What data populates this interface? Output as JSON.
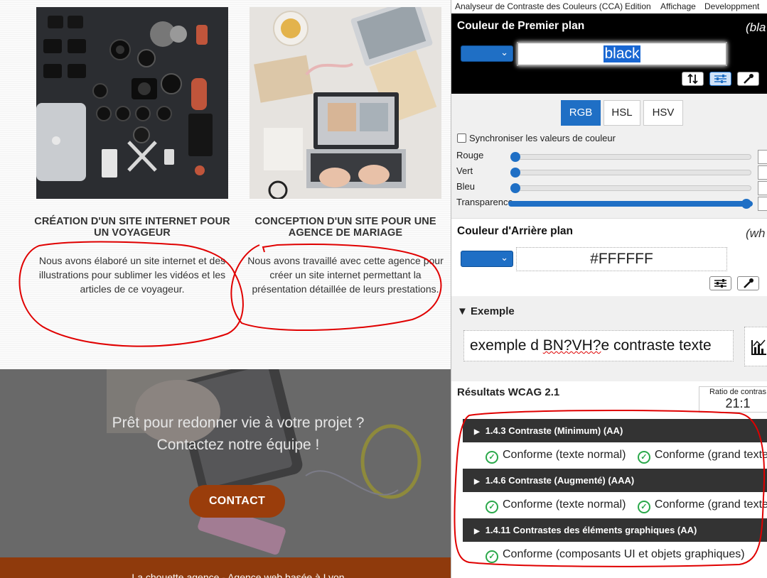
{
  "site": {
    "cards": [
      {
        "title": "CRÉATION D'UN SITE INTERNET POUR UN VOYAGEUR",
        "text": "Nous avons élaboré un site internet et des illustrations pour sublimer les vidéos et les articles de ce voyageur."
      },
      {
        "title": "CONCEPTION D'UN SITE POUR UNE AGENCE DE MARIAGE",
        "text": "Nous avons travaillé avec cette agence pour créer un site internet permettant la présentation détaillée de leurs prestations."
      }
    ],
    "cta": {
      "line1": "Prêt pour redonner vie à votre projet ?",
      "line2": "Contactez notre équipe !",
      "button": "CONTACT"
    },
    "footer": "La chouette agence - Agence web basée à Lyon"
  },
  "cca": {
    "menu": [
      "Analyseur de Contraste des Couleurs (CCA)",
      "Edition",
      "Affichage",
      "Developpment"
    ],
    "foreground": {
      "title": "Couleur de Premier plan",
      "name": "(bla",
      "value": "black"
    },
    "tabs": [
      "RGB",
      "HSL",
      "HSV"
    ],
    "sync_label": "Synchroniser les valeurs de couleur",
    "sliders": [
      {
        "label": "Rouge",
        "level": 0
      },
      {
        "label": "Vert",
        "level": 0
      },
      {
        "label": "Bleu",
        "level": 0
      },
      {
        "label": "Transparence",
        "level": 1
      }
    ],
    "background": {
      "title": "Couleur d'Arrière plan",
      "name": "(wh",
      "value": "#FFFFFF"
    },
    "example": {
      "title": "Exemple",
      "text_a": "exemple d ",
      "text_b": "BN?VH?",
      "text_c": "e contraste texte"
    },
    "results": {
      "title": "Résultats WCAG 2.1",
      "ratio_label": "Ratio de contras",
      "ratio_value": "21:1",
      "criteria": [
        {
          "title": "1.4.3 Contraste (Minimum) (AA)",
          "pass_normal": "Conforme (texte normal)",
          "pass_large": "Conforme (grand texte"
        },
        {
          "title": "1.4.6 Contraste (Augmenté) (AAA)",
          "pass_normal": "Conforme (texte normal)",
          "pass_large": "Conforme (grand texte"
        },
        {
          "title": "1.4.11 Contrastes des éléments graphiques (AA)",
          "pass_ui": "Conforme (composants UI et objets graphiques)"
        }
      ]
    },
    "colors": {
      "accent": "#1f6fc5",
      "pass": "#2aa84a",
      "annotation": "#e00000"
    }
  }
}
